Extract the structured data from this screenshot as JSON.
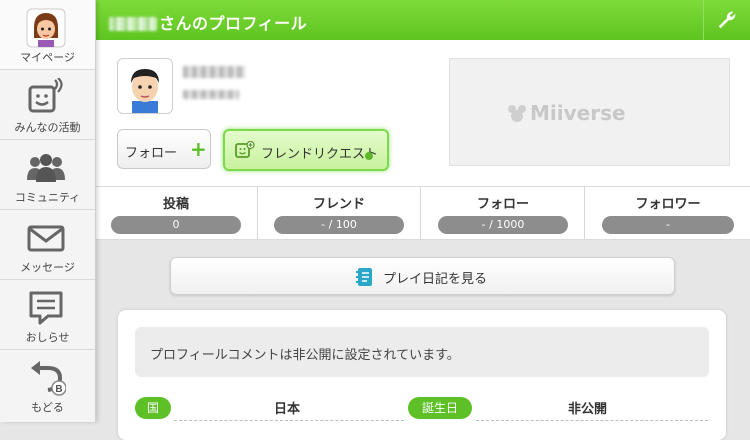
{
  "sidebar": {
    "items": [
      {
        "label": "マイページ",
        "icon": "mii-face-icon"
      },
      {
        "label": "みんなの活動",
        "icon": "activity-feed-icon"
      },
      {
        "label": "コミュニティ",
        "icon": "community-people-icon"
      },
      {
        "label": "メッセージ",
        "icon": "envelope-icon"
      },
      {
        "label": "おしらせ",
        "icon": "speech-bubble-icon"
      },
      {
        "label": "もどる",
        "icon": "back-arrow-icon",
        "button_hint": "B"
      }
    ]
  },
  "header": {
    "title": "さんのプロフィール",
    "settings_icon": "wrench-icon",
    "color": "#6bd02c"
  },
  "profile": {
    "follow_label": "フォロー",
    "friend_request_label": "フレンドリクエスト",
    "banner_logo": "Miiverse"
  },
  "stats": [
    {
      "label": "投稿",
      "value": "0"
    },
    {
      "label": "フレンド",
      "value": "- / 100"
    },
    {
      "label": "フォロー",
      "value": "- / 1000"
    },
    {
      "label": "フォロワー",
      "value": "-"
    }
  ],
  "main": {
    "diary_label": "プレイ日記を見る",
    "profile_comment": "プロフィールコメントは非公開に設定されています。",
    "fields": [
      {
        "label": "国",
        "value": "日本"
      },
      {
        "label": "誕生日",
        "value": "非公開"
      }
    ]
  }
}
